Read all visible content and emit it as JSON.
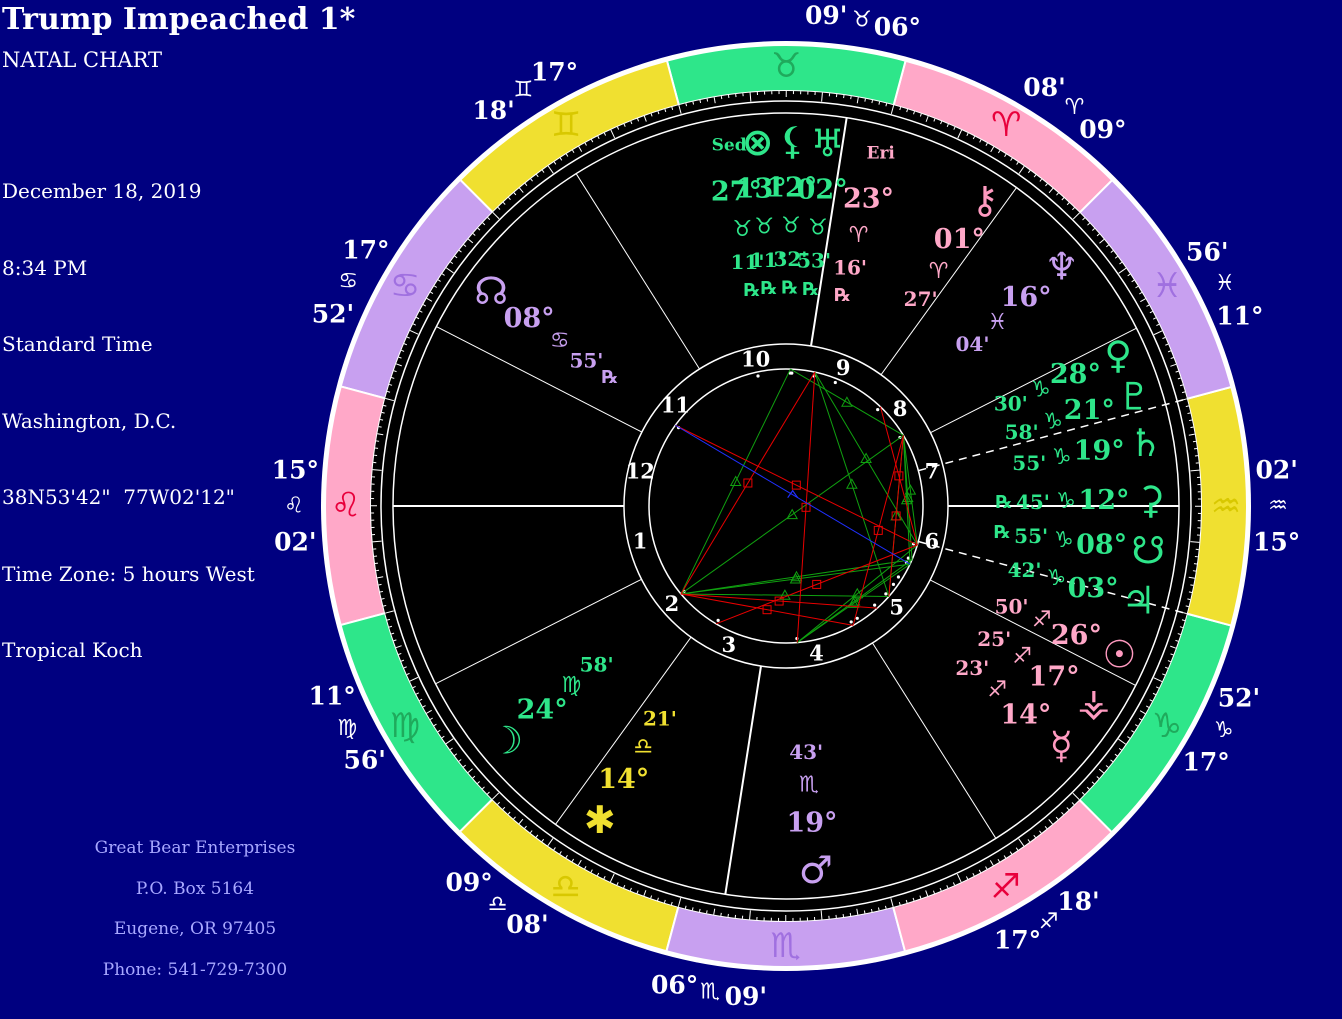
{
  "header": {
    "title": "Trump Impeached 1*",
    "subtitle": "NATAL CHART",
    "info_lines": [
      "December 18, 2019",
      "8:34 PM",
      "Standard Time",
      "Washington, D.C.",
      "38N53'42\"  77W02'12\"",
      "Time Zone: 5 hours West",
      "Tropical Koch"
    ]
  },
  "footer": {
    "lines": [
      "Great Bear Enterprises",
      "P.O. Box 5164",
      "Eugene, OR 97405",
      "Phone: 541-729-7300"
    ]
  },
  "colors": {
    "background": "#000080",
    "fire": "#ffa8c8",
    "earth": "#2ee68a",
    "air": "#f0e030",
    "water": "#c8a0f0",
    "fire_glyph": "#e8003c",
    "earth_glyph": "#1faa5c",
    "air_glyph": "#d8c800",
    "water_glyph": "#a070e0",
    "hard_aspect": "#e80000",
    "soft_aspect": "#10a010",
    "other_aspect": "#2030ff"
  },
  "chart_data": {
    "type": "natal_wheel",
    "signs": [
      {
        "name": "Aries",
        "glyph": "♈",
        "element": "fire"
      },
      {
        "name": "Taurus",
        "glyph": "♉",
        "element": "earth"
      },
      {
        "name": "Gemini",
        "glyph": "♊",
        "element": "air"
      },
      {
        "name": "Cancer",
        "glyph": "♋",
        "element": "water"
      },
      {
        "name": "Leo",
        "glyph": "♌",
        "element": "fire"
      },
      {
        "name": "Virgo",
        "glyph": "♍",
        "element": "earth"
      },
      {
        "name": "Libra",
        "glyph": "♎",
        "element": "air"
      },
      {
        "name": "Scorpio",
        "glyph": "♏",
        "element": "water"
      },
      {
        "name": "Sagittarius",
        "glyph": "♐",
        "element": "fire"
      },
      {
        "name": "Capricorn",
        "glyph": "♑",
        "element": "earth"
      },
      {
        "name": "Aquarius",
        "glyph": "♒",
        "element": "air"
      },
      {
        "name": "Pisces",
        "glyph": "♓",
        "element": "water"
      }
    ],
    "cusps": [
      {
        "house": 1,
        "sign": "Leo",
        "deg": "15°",
        "min": "02'",
        "lon": 135.033
      },
      {
        "house": 2,
        "sign": "Virgo",
        "deg": "11°",
        "min": "56'",
        "lon": 161.933
      },
      {
        "house": 3,
        "sign": "Libra",
        "deg": "09°",
        "min": "08'",
        "lon": 189.133
      },
      {
        "house": 4,
        "sign": "Scorpio",
        "deg": "06°",
        "min": "09'",
        "lon": 216.15
      },
      {
        "house": 5,
        "sign": "Sagittarius",
        "deg": "17°",
        "min": "18'",
        "lon": 257.3
      },
      {
        "house": 6,
        "sign": "Capricorn",
        "deg": "17°",
        "min": "52'",
        "lon": 287.867
      },
      {
        "house": 7,
        "sign": "Aquarius",
        "deg": "15°",
        "min": "02'",
        "lon": 315.033
      },
      {
        "house": 8,
        "sign": "Pisces",
        "deg": "11°",
        "min": "56'",
        "lon": 341.933
      },
      {
        "house": 9,
        "sign": "Aries",
        "deg": "09°",
        "min": "08'",
        "lon": 9.133
      },
      {
        "house": 10,
        "sign": "Taurus",
        "deg": "06°",
        "min": "09'",
        "lon": 36.15
      },
      {
        "house": 11,
        "sign": "Gemini",
        "deg": "17°",
        "min": "18'",
        "lon": 77.3
      },
      {
        "house": 12,
        "sign": "Cancer",
        "deg": "17°",
        "min": "52'",
        "lon": 107.867
      }
    ],
    "house_numbers": [
      "1",
      "2",
      "3",
      "4",
      "5",
      "6",
      "7",
      "8",
      "9",
      "10",
      "11",
      "12"
    ],
    "planets": [
      {
        "name": "Sedna",
        "glyph": "Sed",
        "deg": "27°",
        "sign": "Taurus",
        "min": "11'",
        "retro": "℞",
        "lon": 57.18,
        "disp": 54,
        "element": "earth"
      },
      {
        "name": "Part of Fortune",
        "glyph": "⊗",
        "deg": "13°",
        "sign": "Taurus",
        "min": "11'",
        "retro": "℞",
        "lon": 43.18,
        "disp": 49.5,
        "element": "earth"
      },
      {
        "name": "Black Moon",
        "glyph": "⚸",
        "deg": "12°",
        "sign": "Taurus",
        "min": "32'",
        "retro": "℞",
        "lon": 42.53,
        "disp": 44,
        "element": "earth"
      },
      {
        "name": "Uranus",
        "glyph": "♅",
        "deg": "02°",
        "sign": "Taurus",
        "min": "53'",
        "retro": "℞",
        "lon": 32.88,
        "disp": 38.5,
        "element": "earth"
      },
      {
        "name": "Eris",
        "glyph": "Eri",
        "deg": "23°",
        "sign": "Aries",
        "min": "16'",
        "retro": "℞",
        "lon": 23.27,
        "disp": 30,
        "element": "fire"
      },
      {
        "name": "Chiron",
        "glyph": "⚷",
        "deg": "01°",
        "sign": "Aries",
        "min": "27'",
        "retro": "",
        "lon": 1.45,
        "disp": 12,
        "element": "fire"
      },
      {
        "name": "Neptune",
        "glyph": "♆",
        "deg": "16°",
        "sign": "Pisces",
        "min": "04'",
        "retro": "",
        "lon": 346.07,
        "disp": 356,
        "element": "water"
      },
      {
        "name": "Venus",
        "glyph": "♀",
        "deg": "28°",
        "sign": "Capricorn",
        "min": "30'",
        "retro": "",
        "lon": 298.5,
        "disp": 339.5,
        "element": "earth"
      },
      {
        "name": "Pluto",
        "glyph": "♇",
        "deg": "21°",
        "sign": "Capricorn",
        "min": "58'",
        "retro": "",
        "lon": 291.97,
        "disp": 332.5,
        "element": "earth"
      },
      {
        "name": "Saturn",
        "glyph": "♄",
        "deg": "19°",
        "sign": "Capricorn",
        "min": "55'",
        "retro": "",
        "lon": 289.92,
        "disp": 325,
        "element": "earth"
      },
      {
        "name": "Ceres",
        "glyph": "⚳",
        "deg": "12°",
        "sign": "Capricorn",
        "min": "45'",
        "retro": "℞",
        "lon": 282.75,
        "disp": 316,
        "element": "earth"
      },
      {
        "name": "South Node",
        "glyph": "☋",
        "deg": "08°",
        "sign": "Capricorn",
        "min": "55'",
        "retro": "℞",
        "lon": 278.92,
        "disp": 308,
        "element": "earth"
      },
      {
        "name": "Jupiter",
        "glyph": "♃",
        "deg": "03°",
        "sign": "Capricorn",
        "min": "42'",
        "retro": "",
        "lon": 273.7,
        "disp": 300,
        "element": "earth"
      },
      {
        "name": "Sun",
        "glyph": "☉",
        "deg": "26°",
        "sign": "Sagittarius",
        "min": "50'",
        "retro": "",
        "lon": 266.83,
        "disp": 291,
        "element": "fire"
      },
      {
        "name": "Vesta",
        "glyph": "⚶",
        "deg": "17°",
        "sign": "Sagittarius",
        "min": "25'",
        "retro": "",
        "lon": 257.42,
        "disp": 282.5,
        "element": "fire"
      },
      {
        "name": "Mercury",
        "glyph": "☿",
        "deg": "14°",
        "sign": "Sagittarius",
        "min": "23'",
        "retro": "",
        "lon": 254.38,
        "disp": 274,
        "element": "fire"
      },
      {
        "name": "Mars",
        "glyph": "♂",
        "deg": "19°",
        "sign": "Scorpio",
        "min": "43'",
        "retro": "",
        "lon": 229.72,
        "disp": 229.72,
        "element": "water"
      },
      {
        "name": "Juno",
        "glyph": "✱",
        "deg": "14°",
        "sign": "Libra",
        "min": "21'",
        "retro": "",
        "lon": 194.35,
        "disp": 194.35,
        "element": "air"
      },
      {
        "name": "Moon",
        "glyph": "☽",
        "deg": "24°",
        "sign": "Virgo",
        "min": "58'",
        "retro": "",
        "lon": 174.97,
        "disp": 174.97,
        "element": "earth"
      },
      {
        "name": "North Node",
        "glyph": "☊",
        "deg": "08°",
        "sign": "Cancer",
        "min": "55'",
        "retro": "℞",
        "lon": 98.92,
        "disp": 98.92,
        "element": "water"
      }
    ],
    "aspects": [
      {
        "a": "Neptune",
        "b": "Saturn",
        "kind": "soft"
      },
      {
        "a": "Neptune",
        "b": "Pluto",
        "kind": "soft"
      },
      {
        "a": "Neptune",
        "b": "Venus",
        "kind": "soft"
      },
      {
        "a": "Neptune",
        "b": "Jupiter",
        "kind": "soft"
      },
      {
        "a": "Neptune",
        "b": "Moon",
        "kind": "soft"
      },
      {
        "a": "Neptune",
        "b": "Part of Fortune",
        "kind": "soft"
      },
      {
        "a": "Venus",
        "b": "Mars",
        "kind": "soft"
      },
      {
        "a": "Pluto",
        "b": "Moon",
        "kind": "soft"
      },
      {
        "a": "Saturn",
        "b": "Moon",
        "kind": "soft"
      },
      {
        "a": "Jupiter",
        "b": "Moon",
        "kind": "soft"
      },
      {
        "a": "Pluto",
        "b": "Mars",
        "kind": "soft"
      },
      {
        "a": "Saturn",
        "b": "Mars",
        "kind": "soft"
      },
      {
        "a": "Uranus",
        "b": "Jupiter",
        "kind": "soft"
      },
      {
        "a": "Uranus",
        "b": "Venus",
        "kind": "soft"
      },
      {
        "a": "Part of Fortune",
        "b": "Moon",
        "kind": "soft"
      },
      {
        "a": "Moon",
        "b": "Mercury",
        "kind": "hard"
      },
      {
        "a": "Moon",
        "b": "Uranus",
        "kind": "hard"
      },
      {
        "a": "Sun",
        "b": "Moon",
        "kind": "hard"
      },
      {
        "a": "Uranus",
        "b": "Mars",
        "kind": "hard"
      },
      {
        "a": "Neptune",
        "b": "Mercury",
        "kind": "hard"
      },
      {
        "a": "Neptune",
        "b": "Jupiter",
        "kind": "hard"
      },
      {
        "a": "Venus",
        "b": "North Node",
        "kind": "hard"
      },
      {
        "a": "Venus",
        "b": "Juno",
        "kind": "hard"
      },
      {
        "a": "Chiron",
        "b": "Venus",
        "kind": "hard"
      },
      {
        "a": "North Node",
        "b": "Saturn",
        "kind": "other"
      }
    ]
  }
}
